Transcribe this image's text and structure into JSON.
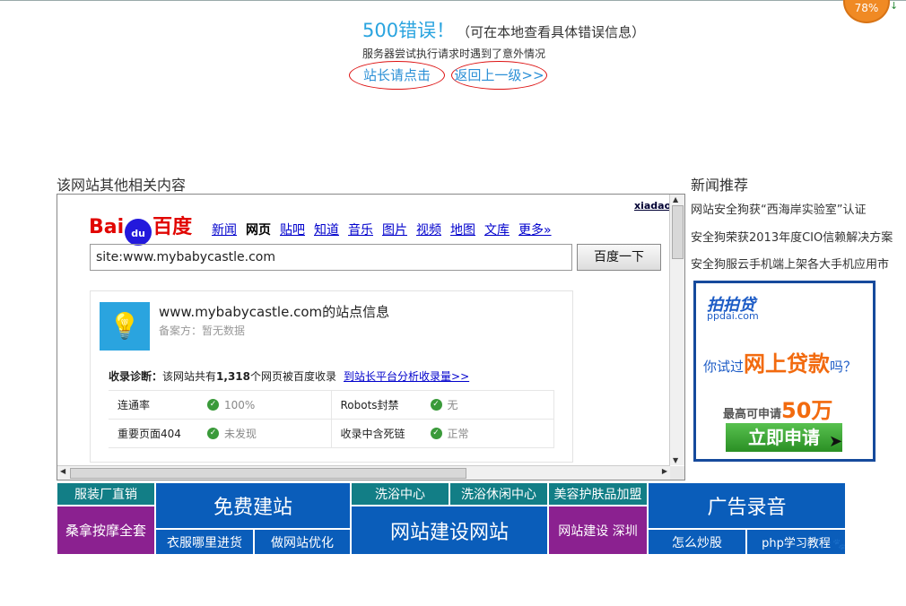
{
  "error": {
    "title": "500错误！",
    "subtitle": "（可在本地查看具体错误信息）",
    "description": "服务器尝试执行请求时遇到了意外情况",
    "admin_link": "站长请点击",
    "back_link": "返回上一级>>"
  },
  "badge_text": "78%",
  "related": {
    "title": "该网站其他相关内容",
    "xiadao_link": "xiadao",
    "baidu": {
      "logo_bai": "Bai",
      "logo_du": "du",
      "logo_cn": "百度",
      "nav": [
        "新闻",
        "网页",
        "贴吧",
        "知道",
        "音乐",
        "图片",
        "视频",
        "地图",
        "文库",
        "更多»"
      ],
      "search_value": "site:www.mybabycastle.com",
      "search_button": "百度一下",
      "site_info": "www.mybabycastle.com的站点信息",
      "beian": "备案方：暂无数据",
      "diag_label": "收录诊断：",
      "diag_text_a": "该网站共有",
      "diag_count": "1,318",
      "diag_text_b": "个网页被百度收录",
      "diag_link": "到站长平台分析收录量>>",
      "stats": [
        {
          "label": "连通率",
          "value": "100%"
        },
        {
          "label": "Robots封禁",
          "value": "无"
        },
        {
          "label": "重要页面404",
          "value": "未发现"
        },
        {
          "label": "收录中含死链",
          "value": "正常"
        }
      ]
    }
  },
  "news": {
    "title": "新闻推荐",
    "items": [
      "网站安全狗获“西海岸实验室”认证",
      "安全狗荣获2013年度CIO信赖解决方案",
      "安全狗服云手机端上架各大手机应用市"
    ]
  },
  "ad": {
    "brand": "拍拍贷",
    "brand_url": "ppdai.com",
    "question_a": "你试过",
    "question_big": "网上贷款",
    "question_b": "吗？",
    "max_a": "最高可申请",
    "max_num": "50万",
    "apply": "立即申请"
  },
  "tiles": {
    "t1": "服装厂直销",
    "t2": "桑拿按摩全套",
    "t3": "免费建站",
    "t4": "衣服哪里进货",
    "t5": "做网站优化",
    "t6": "洗浴中心",
    "t7": "洗浴休闲中心",
    "t8": "网站建设网站",
    "t9": "美容护肤品加盟",
    "t10": "网站建设 深圳",
    "t11": "广告录音",
    "t12": "怎么炒股",
    "t13": "php学习教程"
  }
}
